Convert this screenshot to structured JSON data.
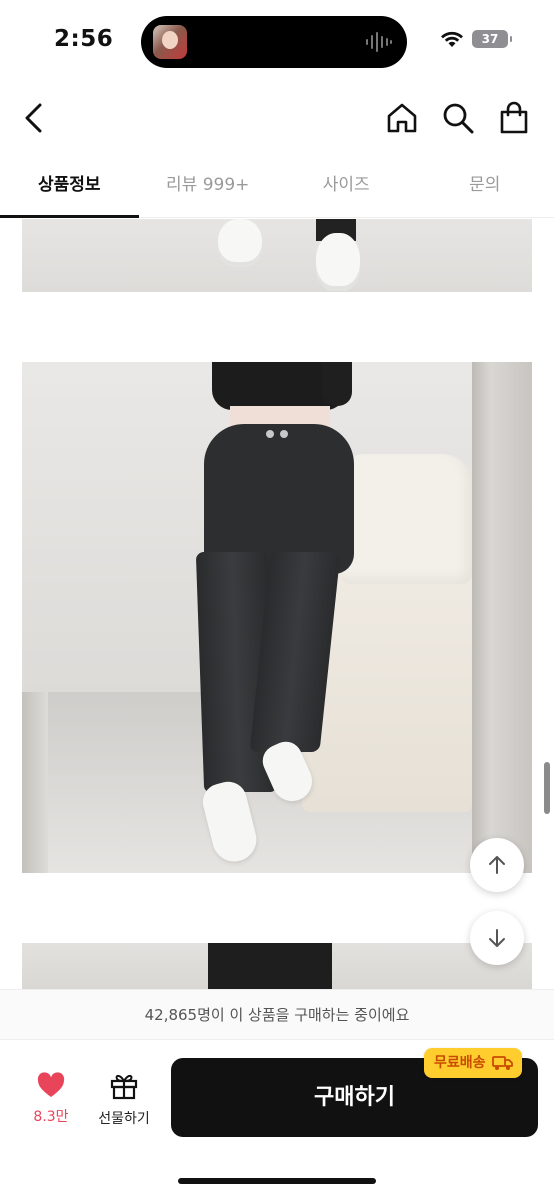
{
  "status_bar": {
    "time": "2:56",
    "battery": "37"
  },
  "header": {
    "back_icon": "chevron-left-icon",
    "home_icon": "home-icon",
    "search_icon": "search-icon",
    "cart_icon": "shopping-bag-icon"
  },
  "tabs": [
    {
      "label": "상품정보",
      "active": true
    },
    {
      "label": "리뷰 999+",
      "active": false
    },
    {
      "label": "사이즈",
      "active": false
    },
    {
      "label": "문의",
      "active": false
    }
  ],
  "floating": {
    "up_icon": "arrow-up-icon",
    "down_icon": "arrow-down-icon"
  },
  "buyer_banner": "42,865명이 이 상품을 구매하는 중이에요",
  "bottom_bar": {
    "like_count": "8.3만",
    "gift_label": "선물하기",
    "buy_label": "구매하기",
    "shipping_badge": "무료배송",
    "accent_color": "#e8455b",
    "badge_color": "#ffce2e"
  }
}
